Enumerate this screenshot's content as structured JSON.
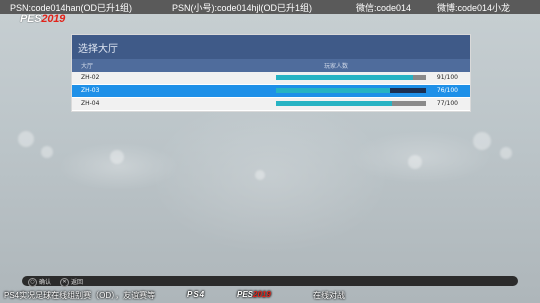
{
  "header": {
    "items": [
      "PSN:code014han(OD已升1组)",
      "PSN(小号):code014hjl(OD已升1组)",
      "微信:code014",
      "微博:code014小龙"
    ],
    "logo_pes": "PES",
    "logo_year": "2019"
  },
  "lobby": {
    "title": "选择大厅",
    "col_lobby": "大厅",
    "col_players": "玩家人数",
    "rows": [
      {
        "name": "ZH-02",
        "count": "91/100",
        "fill": 0.91,
        "selected": false
      },
      {
        "name": "ZH-03",
        "count": "76/100",
        "fill": 0.76,
        "selected": true
      },
      {
        "name": "ZH-04",
        "count": "77/100",
        "fill": 0.77,
        "selected": false
      }
    ]
  },
  "footer": {
    "confirm_label": "确认",
    "back_label": "返回",
    "confirm_icon": "circle-icon",
    "back_icon": "cross-icon"
  },
  "caption": {
    "left": "PS4实况足球在线组别赛（OD），友谊赛等",
    "ps4": "PS4",
    "pes": "PES",
    "year": "2019",
    "right": "在线对战"
  },
  "colors": {
    "panel_header": "#3f5a88",
    "selection": "#1e90e8",
    "fill": "#27b3c3",
    "brand_red": "#e2231a"
  }
}
